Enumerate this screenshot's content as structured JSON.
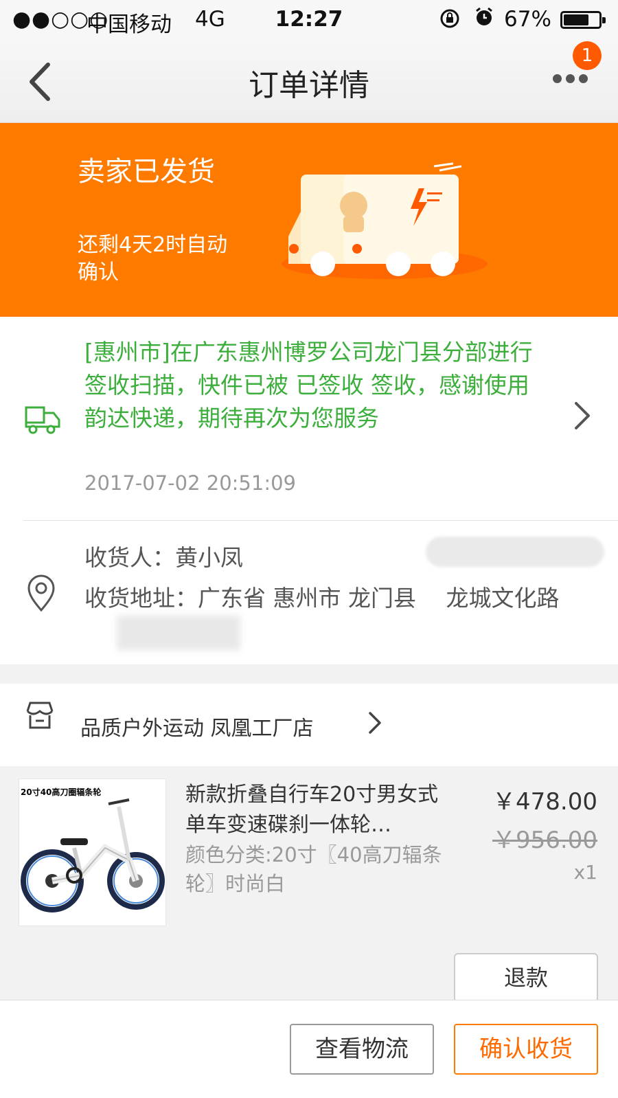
{
  "status_bar": {
    "signal": "●●○○○",
    "carrier": "中国移动",
    "network": "4G",
    "time": "12:27",
    "battery": "67%",
    "battery_level": 0.67
  },
  "nav": {
    "title": "订单详情",
    "badge_count": "1"
  },
  "banner": {
    "status": "卖家已发货",
    "countdown": "还剩4天2时自动确认",
    "color": "#ff7b00"
  },
  "logistics": {
    "message": "[惠州市]在广东惠州博罗公司龙门县分部进行签收扫描，快件已被 已签收 签收，感谢使用韵达快递，期待再次为您服务",
    "time": "2017-07-02 20:51:09",
    "text_color": "#3cae3c"
  },
  "address": {
    "recipient": "收货人：黄小凤",
    "address": "收货地址：广东省 惠州市 龙门县　 龙城文化路"
  },
  "shop": {
    "name": "品质户外运动 凤凰工厂店"
  },
  "item": {
    "thumb_label": "20寸40高刀圈辐条轮",
    "title": "新款折叠自行车20寸男女式单车变速碟刹一体轮…",
    "spec": "颜色分类:20寸〖40高刀辐条轮〗时尚白",
    "price": "￥478.00",
    "original_price": "￥956.00",
    "quantity": "x1",
    "refund_label": "退款"
  },
  "footer": {
    "view_logistics": "查看物流",
    "confirm_receipt": "确认收货"
  }
}
